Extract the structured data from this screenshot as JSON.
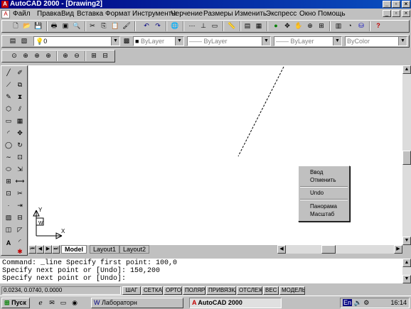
{
  "window": {
    "title": "AutoCAD 2000 - [Drawing2]",
    "app_icon": "autocad-logo",
    "controls": {
      "minimize": "_",
      "restore": "▫",
      "close": "×"
    },
    "doc_controls": {
      "minimize": "_",
      "restore": "▫",
      "close": "×"
    }
  },
  "menubar": {
    "items": [
      "Файл",
      "Правка",
      "Вид",
      "Вставка",
      "Формат",
      "Инструменты",
      "Черчение",
      "Размеры",
      "Изменить",
      "Экспресс",
      "Окно",
      "Помощь"
    ]
  },
  "toolbars": {
    "standard_icons": [
      "new-icon",
      "open-icon",
      "save-icon",
      "print-icon",
      "preview-icon",
      "find-icon",
      "cut-icon",
      "copy-icon",
      "paste-icon",
      "match-properties-icon",
      "undo-icon",
      "redo-icon",
      "hyperlink-icon",
      "tracking-icon",
      "ucs-icon",
      "tiles-icon",
      "distance-icon",
      "properties-icon",
      "design-center-icon",
      "edit-icon",
      "layer-icon",
      "pan-icon",
      "zoom-icon",
      "zoom-window-icon",
      "zoom-previous-icon",
      "aerial-view-icon",
      "help-icon"
    ],
    "layer_combo": "0",
    "color_combo": "ByLayer",
    "linetype_combo": "ByLayer",
    "lineweight_combo": "ByLayer",
    "plotstyle_combo": "ByColor",
    "zoom_icons": [
      "zoom-realtime-icon",
      "zoom-window-icon",
      "zoom-dynamic-icon",
      "zoom-scale-icon",
      "zoom-center-icon",
      "zoom-in-icon",
      "zoom-out-icon",
      "zoom-all-icon",
      "zoom-extents-icon"
    ]
  },
  "left_toolbar": {
    "col1": [
      "line-icon",
      "construction-line-icon",
      "polyline-icon",
      "polygon-icon",
      "rectangle-icon",
      "arc-icon",
      "circle-icon",
      "spline-icon",
      "ellipse-icon",
      "insert-block-icon",
      "make-block-icon",
      "point-icon",
      "hatch-icon",
      "region-icon",
      "text-icon"
    ],
    "col2": [
      "erase-icon",
      "copy-object-icon",
      "mirror-icon",
      "offset-icon",
      "array-icon",
      "move-icon",
      "rotate-icon",
      "scale-icon",
      "stretch-icon",
      "lengthen-icon",
      "trim-icon",
      "extend-icon",
      "break-icon",
      "chamfer-icon",
      "fillet-icon",
      "explode-icon"
    ]
  },
  "layout_tabs": [
    "Model",
    "Layout1",
    "Layout2"
  ],
  "context_menu": {
    "items": [
      "Ввод",
      "Отменить",
      "Undo",
      "Панорама",
      "Масштаб"
    ]
  },
  "command_lines": [
    "Command: _line Specify first point: 100,0",
    "Specify next point or [Undo]: 150,200",
    "Specify next point or [Undo]:"
  ],
  "status": {
    "coords": "0.0234, 0.0740, 0.0000",
    "toggles": [
      "ШАГ",
      "СЕТКА",
      "ОРТО",
      "ПОЛЯР",
      "ПРИВЯЗКА",
      "ОТСЛЕЖ",
      "ВЕС",
      "МОДЕЛЬ"
    ]
  },
  "taskbar": {
    "start_label": "Пуск",
    "tasks": [
      "Лабораторн",
      "AutoCAD 2000"
    ],
    "clock": "16:14"
  },
  "colors": {
    "titlebar": "#000080",
    "canvas": "#ffffff",
    "line": "#000000"
  }
}
